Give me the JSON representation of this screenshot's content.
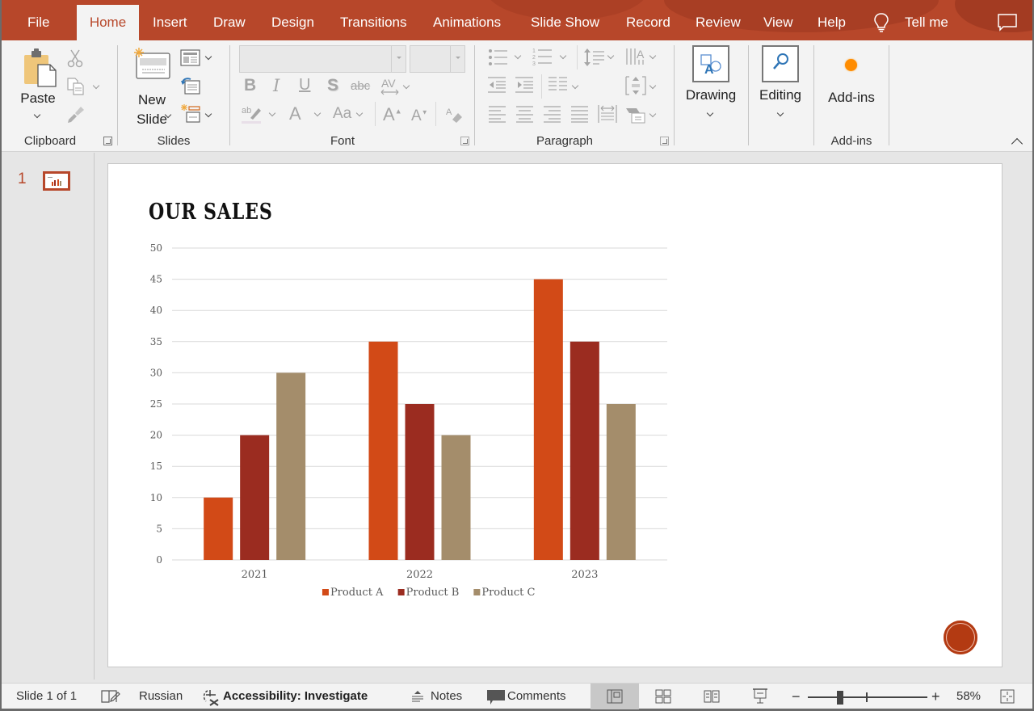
{
  "tabs": {
    "items": [
      {
        "label": "File"
      },
      {
        "label": "Home",
        "active": true
      },
      {
        "label": "Insert"
      },
      {
        "label": "Draw"
      },
      {
        "label": "Design"
      },
      {
        "label": "Transitions"
      },
      {
        "label": "Animations"
      },
      {
        "label": "Slide Show"
      },
      {
        "label": "Record"
      },
      {
        "label": "Review"
      },
      {
        "label": "View"
      },
      {
        "label": "Help"
      }
    ],
    "tell_me": "Tell me",
    "accent_color": "#b7472a"
  },
  "ribbon": {
    "clipboard": {
      "paste_label": "Paste",
      "group_label": "Clipboard"
    },
    "slides": {
      "new_slide_line1": "New",
      "new_slide_line2": "Slide",
      "group_label": "Slides"
    },
    "font": {
      "group_label": "Font",
      "font_name_value": "",
      "font_size_value": ""
    },
    "paragraph": {
      "group_label": "Paragraph"
    },
    "drawing": {
      "label": "Drawing"
    },
    "editing": {
      "label": "Editing"
    },
    "addins": {
      "label": "Add-ins",
      "group_label": "Add-ins"
    }
  },
  "thumbnails": {
    "items": [
      {
        "number": "1"
      }
    ]
  },
  "slide": {
    "title": "OUR SALES"
  },
  "chart_data": {
    "type": "bar",
    "title": "",
    "categories": [
      "2021",
      "2022",
      "2023"
    ],
    "series": [
      {
        "name": "Product A",
        "color": "#d24a17",
        "values": [
          10,
          35,
          45
        ]
      },
      {
        "name": "Product B",
        "color": "#9b2c20",
        "values": [
          20,
          25,
          35
        ]
      },
      {
        "name": "Product C",
        "color": "#a48d6b",
        "values": [
          30,
          20,
          25
        ]
      }
    ],
    "xlabel": "",
    "ylabel": "",
    "ylim": [
      0,
      50
    ],
    "yticks": [
      0,
      5,
      10,
      15,
      20,
      25,
      30,
      35,
      40,
      45,
      50
    ],
    "grid": true,
    "legend": "bottom"
  },
  "statusbar": {
    "slide_info": "Slide 1 of 1",
    "language": "Russian",
    "accessibility": "Accessibility: Investigate",
    "notes": "Notes",
    "comments": "Comments",
    "zoom_level": "58%",
    "zoom_percent": 58
  }
}
